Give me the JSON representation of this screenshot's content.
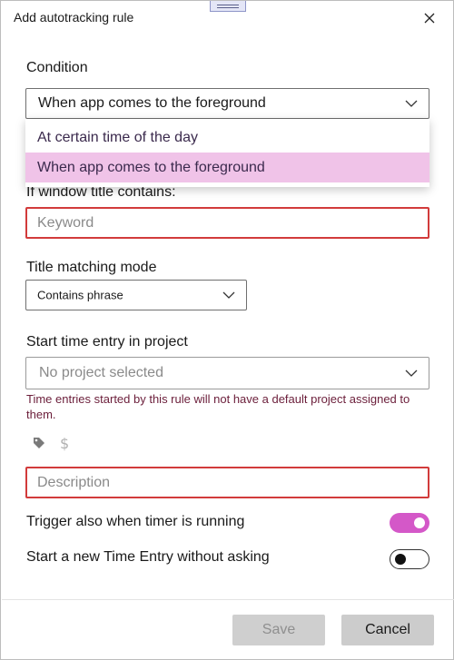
{
  "dialog": {
    "title": "Add autotracking rule"
  },
  "condition": {
    "label": "Condition",
    "selected": "When app comes to the foreground",
    "options": [
      "At certain time of the day",
      "When app comes to the foreground"
    ]
  },
  "window_title": {
    "label": "If window title contains:",
    "placeholder": "Keyword"
  },
  "title_matching": {
    "label": "Title matching mode",
    "selected": "Contains phrase"
  },
  "project": {
    "label": "Start time entry in project",
    "selected": "No project selected",
    "hint": "Time entries started by this rule will not have a default project assigned to them."
  },
  "description": {
    "placeholder": "Description"
  },
  "toggles": {
    "trigger_running": {
      "label": "Trigger also when timer is running",
      "on": true
    },
    "new_entry": {
      "label": "Start a new Time Entry without asking",
      "on": false
    }
  },
  "footer": {
    "save_label": "Save",
    "cancel_label": "Cancel"
  },
  "colors": {
    "accent": "#d458c8",
    "error": "#d23b3b",
    "selected_option": "#f0c3e8"
  },
  "icons": [
    "close-icon",
    "chevron-down-icon",
    "tag-icon",
    "dollar-icon"
  ]
}
